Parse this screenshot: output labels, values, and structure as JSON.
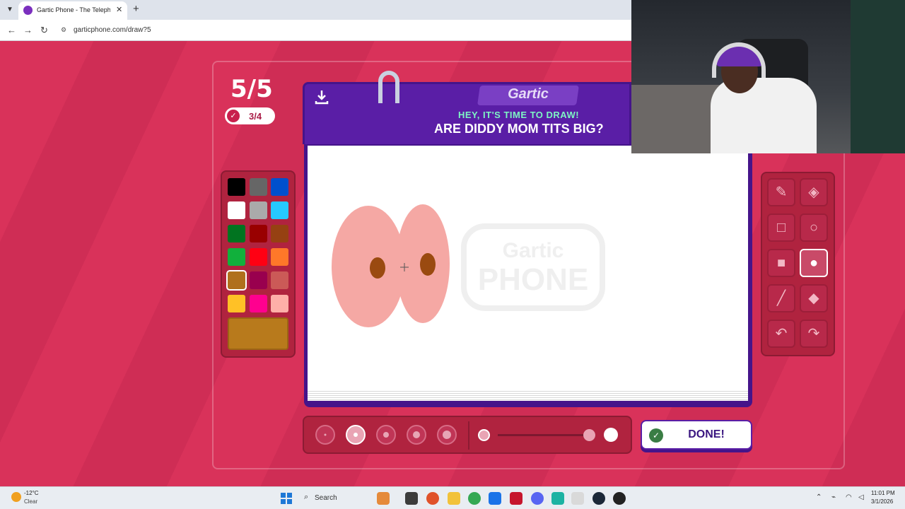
{
  "browser": {
    "tab_title": "Gartic Phone - The Telephone G",
    "url": "garticphone.com/draw?5",
    "tab_menu_icon": "chevron-down-icon",
    "new_tab_icon": "plus-icon"
  },
  "game": {
    "round": "5/5",
    "players_done": "3/4",
    "logo": "Gartic",
    "prompt_label": "HEY, IT'S TIME TO DRAW!",
    "prompt": "ARE DIDDY MOM TITS BIG?",
    "watermark_line1": "Gartic",
    "watermark_line2": "PHONE",
    "done_label": "DONE!"
  },
  "palette": {
    "colors": [
      "#000000",
      "#666666",
      "#0050cd",
      "#ffffff",
      "#aaaaaa",
      "#26c9ff",
      "#017420",
      "#990000",
      "#964112",
      "#11b03c",
      "#ff0013",
      "#ff7829",
      "#b0701c",
      "#99004e",
      "#cb5a57",
      "#ffc126",
      "#ff008f",
      "#feafa8"
    ],
    "selected_index": 12,
    "current_color": "#b87a1c"
  },
  "tools": {
    "items": [
      "pencil-icon",
      "eraser-icon",
      "rectangle-outline-icon",
      "ellipse-outline-icon",
      "rectangle-fill-icon",
      "ellipse-fill-icon",
      "line-icon",
      "bucket-fill-icon",
      "undo-icon",
      "redo-icon"
    ],
    "active_index": 5
  },
  "brush": {
    "sizes": 5,
    "active_size_index": 1,
    "opacity": 0.95
  },
  "drawing": {
    "skin_color": "#f5a8a4",
    "nipple_color": "#9a4a10"
  },
  "taskbar": {
    "weather_temp": "-12°C",
    "weather_desc": "Clear",
    "search_label": "Search",
    "time": "11:01 PM",
    "date": "3/1/2026"
  }
}
